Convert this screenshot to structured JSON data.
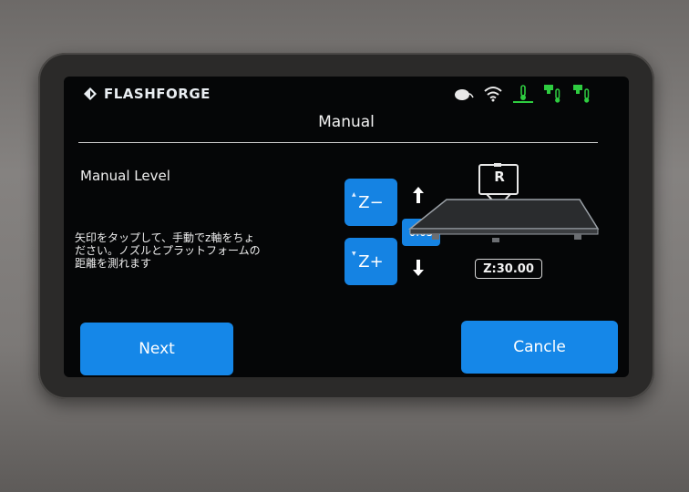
{
  "statusbar": {
    "brand": "FLASHFORGE",
    "icons": [
      "cloud-icon",
      "wifi-icon",
      "bed-temperature-icon",
      "left-extruder-temperature-icon",
      "right-extruder-temperature-icon"
    ],
    "icon_color_green": "#2ecc40",
    "icon_color_white": "#e8e8e8"
  },
  "page": {
    "title": "Manual"
  },
  "main": {
    "level_label": "Manual Level",
    "description_lines": [
      "矢印をタップして、手動でz軸をちょ",
      "ださい。ノズルとプラットフォームの",
      "距離を測れます"
    ],
    "z_minus_label": "Z−",
    "z_plus_label": "Z+",
    "step_value": "0.05",
    "nozzle_label": "R",
    "z_readout": "Z:30.00"
  },
  "buttons": {
    "next_label": "Next",
    "cancel_label": "Cancle"
  },
  "colors": {
    "accent": "#1583e3",
    "screen_bg": "#050607",
    "text": "#f0f0f0"
  }
}
